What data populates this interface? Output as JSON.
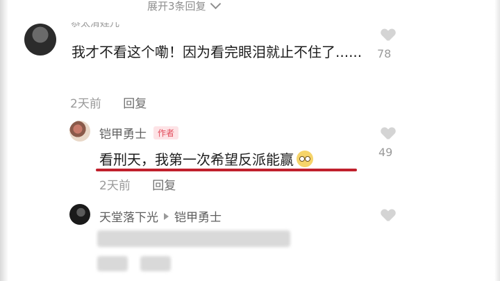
{
  "expand_replies": {
    "label": "展开3条回复"
  },
  "comment_1": {
    "username": "恭太清娃儿",
    "text": "我才不看这个嘞！因为看完眼泪就止不住了......",
    "time": "2天前",
    "reply_label": "回复",
    "likes": "78"
  },
  "reply_1": {
    "username": "铠甲勇士",
    "badge": "作者",
    "text": "看刑天，我第一次希望反派能赢",
    "time": "2天前",
    "reply_label": "回复",
    "likes": "49",
    "emoji_icon": "side-eye-emoji-icon",
    "highlight_color": "#c0202c"
  },
  "reply_2": {
    "username": "天堂落下光",
    "reply_to": "铠甲勇士"
  },
  "colors": {
    "meta_text": "#9a9a9a",
    "badge_bg": "#fde3e6",
    "badge_text": "#e24b5b"
  }
}
